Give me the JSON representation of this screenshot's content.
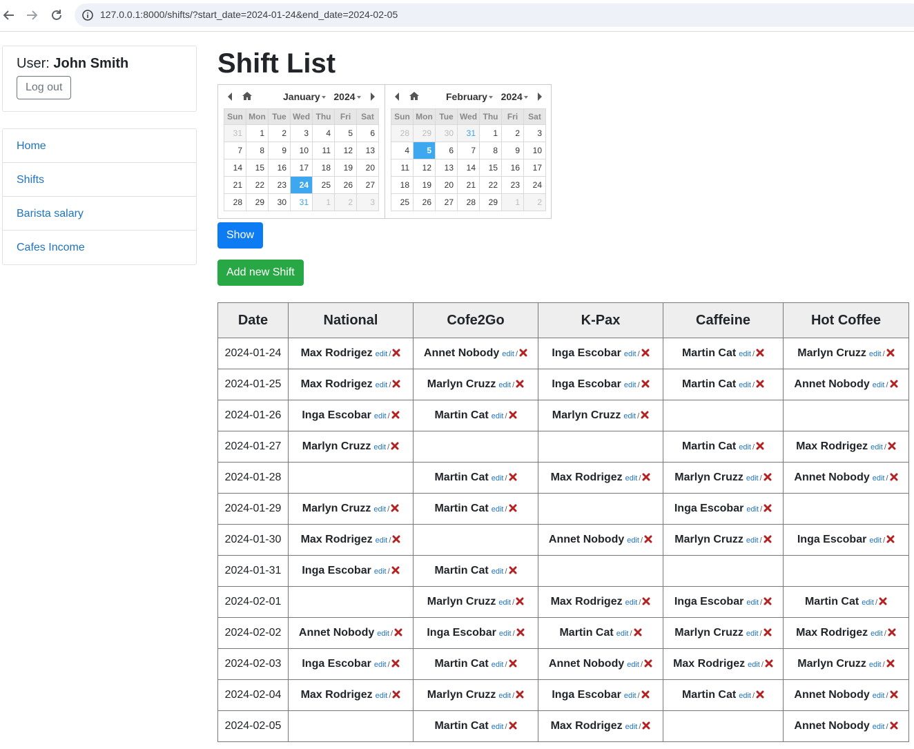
{
  "browser": {
    "url": "127.0.0.1:8000/shifts/?start_date=2024-01-24&end_date=2024-02-05"
  },
  "user": {
    "label": "User:",
    "name": "John Smith",
    "logout_label": "Log out"
  },
  "nav": [
    "Home",
    "Shifts",
    "Barista salary",
    "Cafes Income"
  ],
  "page": {
    "title": "Shift List",
    "show_label": "Show",
    "add_label": "Add new Shift"
  },
  "calendars": [
    {
      "month": "January",
      "year": "2024",
      "weekdays": [
        "Sun",
        "Mon",
        "Tue",
        "Wed",
        "Thu",
        "Fri",
        "Sat"
      ],
      "weeks": [
        [
          {
            "d": "31",
            "s": "muted"
          },
          {
            "d": "1"
          },
          {
            "d": "2"
          },
          {
            "d": "3"
          },
          {
            "d": "4"
          },
          {
            "d": "5"
          },
          {
            "d": "6"
          }
        ],
        [
          {
            "d": "7"
          },
          {
            "d": "8"
          },
          {
            "d": "9"
          },
          {
            "d": "10"
          },
          {
            "d": "11"
          },
          {
            "d": "12"
          },
          {
            "d": "13"
          }
        ],
        [
          {
            "d": "14"
          },
          {
            "d": "15"
          },
          {
            "d": "16"
          },
          {
            "d": "17"
          },
          {
            "d": "18"
          },
          {
            "d": "19"
          },
          {
            "d": "20"
          }
        ],
        [
          {
            "d": "21"
          },
          {
            "d": "22"
          },
          {
            "d": "23"
          },
          {
            "d": "24",
            "s": "sel"
          },
          {
            "d": "25"
          },
          {
            "d": "26"
          },
          {
            "d": "27"
          }
        ],
        [
          {
            "d": "28"
          },
          {
            "d": "29"
          },
          {
            "d": "30"
          },
          {
            "d": "31",
            "s": "inrange"
          },
          {
            "d": "1",
            "s": "muted"
          },
          {
            "d": "2",
            "s": "muted"
          },
          {
            "d": "3",
            "s": "muted"
          }
        ]
      ]
    },
    {
      "month": "February",
      "year": "2024",
      "weekdays": [
        "Sun",
        "Mon",
        "Tue",
        "Wed",
        "Thu",
        "Fri",
        "Sat"
      ],
      "weeks": [
        [
          {
            "d": "28",
            "s": "muted"
          },
          {
            "d": "29",
            "s": "muted"
          },
          {
            "d": "30",
            "s": "muted"
          },
          {
            "d": "31",
            "s": "muted inrange"
          },
          {
            "d": "1"
          },
          {
            "d": "2"
          },
          {
            "d": "3"
          }
        ],
        [
          {
            "d": "4"
          },
          {
            "d": "5",
            "s": "sel"
          },
          {
            "d": "6"
          },
          {
            "d": "7"
          },
          {
            "d": "8"
          },
          {
            "d": "9"
          },
          {
            "d": "10"
          }
        ],
        [
          {
            "d": "11"
          },
          {
            "d": "12"
          },
          {
            "d": "13"
          },
          {
            "d": "14"
          },
          {
            "d": "15"
          },
          {
            "d": "16"
          },
          {
            "d": "17"
          }
        ],
        [
          {
            "d": "18"
          },
          {
            "d": "19"
          },
          {
            "d": "20"
          },
          {
            "d": "21"
          },
          {
            "d": "22"
          },
          {
            "d": "23"
          },
          {
            "d": "24"
          }
        ],
        [
          {
            "d": "25"
          },
          {
            "d": "26"
          },
          {
            "d": "27"
          },
          {
            "d": "28"
          },
          {
            "d": "29"
          },
          {
            "d": "1",
            "s": "muted"
          },
          {
            "d": "2",
            "s": "muted"
          }
        ]
      ]
    }
  ],
  "table": {
    "edit_label": "edit",
    "separator": "/",
    "headers": [
      "Date",
      "National",
      "Cofe2Go",
      "K-Pax",
      "Caffeine",
      "Hot Coffee"
    ],
    "rows": [
      {
        "date": "2024-01-24",
        "cells": [
          "Max Rodrigez",
          "Annet Nobody",
          "Inga Escobar",
          "Martin Cat",
          "Marlyn Cruzz"
        ]
      },
      {
        "date": "2024-01-25",
        "cells": [
          "Max Rodrigez",
          "Marlyn Cruzz",
          "Inga Escobar",
          "Martin Cat",
          "Annet Nobody"
        ]
      },
      {
        "date": "2024-01-26",
        "cells": [
          "Inga Escobar",
          "Martin Cat",
          "Marlyn Cruzz",
          "",
          ""
        ]
      },
      {
        "date": "2024-01-27",
        "cells": [
          "Marlyn Cruzz",
          "",
          "",
          "Martin Cat",
          "Max Rodrigez"
        ]
      },
      {
        "date": "2024-01-28",
        "cells": [
          "",
          "Martin Cat",
          "Max Rodrigez",
          "Marlyn Cruzz",
          "Annet Nobody"
        ]
      },
      {
        "date": "2024-01-29",
        "cells": [
          "Marlyn Cruzz",
          "Martin Cat",
          "",
          "Inga Escobar",
          ""
        ]
      },
      {
        "date": "2024-01-30",
        "cells": [
          "Max Rodrigez",
          "",
          "Annet Nobody",
          "Marlyn Cruzz",
          "Inga Escobar"
        ]
      },
      {
        "date": "2024-01-31",
        "cells": [
          "Inga Escobar",
          "Martin Cat",
          "",
          "",
          ""
        ]
      },
      {
        "date": "2024-02-01",
        "cells": [
          "",
          "Marlyn Cruzz",
          "Max Rodrigez",
          "Inga Escobar",
          "Martin Cat"
        ]
      },
      {
        "date": "2024-02-02",
        "cells": [
          "Annet Nobody",
          "Inga Escobar",
          "Martin Cat",
          "Marlyn Cruzz",
          "Max Rodrigez"
        ]
      },
      {
        "date": "2024-02-03",
        "cells": [
          "Inga Escobar",
          "Martin Cat",
          "Annet Nobody",
          "Max Rodrigez",
          "Marlyn Cruzz"
        ]
      },
      {
        "date": "2024-02-04",
        "cells": [
          "Max Rodrigez",
          "Marlyn Cruzz",
          "Inga Escobar",
          "Martin Cat",
          "Annet Nobody"
        ]
      },
      {
        "date": "2024-02-05",
        "cells": [
          "",
          "Martin Cat",
          "Max Rodrigez",
          "",
          "Annet Nobody"
        ]
      }
    ]
  },
  "colors": {
    "link": "#1e73be",
    "primary": "#0d7cf2",
    "success": "#28a745",
    "selected_day": "#3da7ef",
    "delete": "#b22222"
  }
}
